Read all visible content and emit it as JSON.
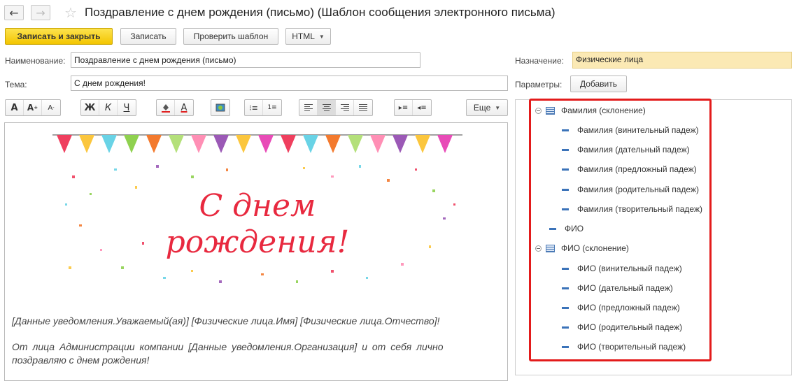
{
  "window": {
    "title": "Поздравление с днем рождения (письмо) (Шаблон сообщения электронного письма)"
  },
  "toolbar": {
    "save_close": "Записать и закрыть",
    "save": "Записать",
    "check": "Проверить шаблон",
    "format": "HTML"
  },
  "form": {
    "name_label": "Наименование:",
    "name_value": "Поздравление с днем рождения (письмо)",
    "subject_label": "Тема:",
    "subject_value": "С днем рождения!",
    "purpose_label": "Назначение:",
    "purpose_value": "Физические лица",
    "params_label": "Параметры:",
    "add_button": "Добавить"
  },
  "format_toolbar": {
    "font_larger": "A",
    "font_bigger": "A",
    "font_smaller": "A",
    "bold": "Ж",
    "italic": "К",
    "underline": "Ч",
    "font_color": "A",
    "more": "Еще"
  },
  "editor": {
    "banner_line1": "С днем",
    "banner_line2": "рождения!",
    "line1": "[Данные уведомления.Уважаемый(ая)] [Физические лица.Имя] [Физические лица.Отчество]!",
    "line2": "От лица Администрации компании [Данные уведомления.Организация] и от себя лично",
    "line3": "поздравляю с днем рождения!",
    "colors": {
      "banner_text": "#e8293f"
    }
  },
  "params_tree": {
    "group1": {
      "label": "Фамилия (склонение)",
      "items": [
        "Фамилия (винительный падеж)",
        "Фамилия (дательный падеж)",
        "Фамилия (предложный падеж)",
        "Фамилия (родительный падеж)",
        "Фамилия (творительный падеж)"
      ]
    },
    "fio": "ФИО",
    "group2": {
      "label": "ФИО (склонение)",
      "items": [
        "ФИО (винительный падеж)",
        "ФИО (дательный падеж)",
        "ФИО (предложный падеж)",
        "ФИО (родительный падеж)",
        "ФИО (творительный падеж)"
      ]
    }
  }
}
